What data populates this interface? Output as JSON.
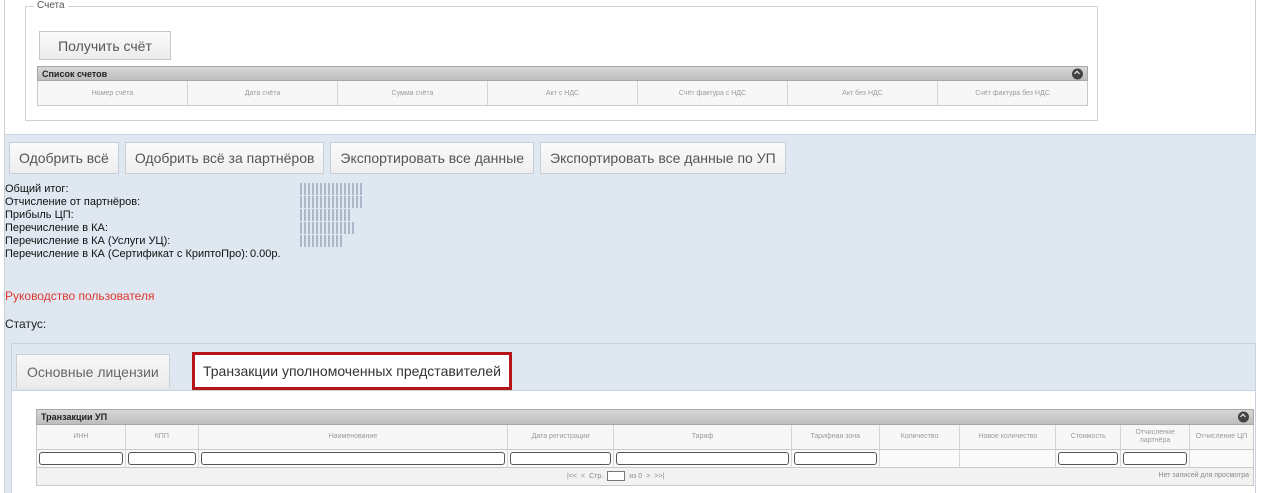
{
  "invoices": {
    "legend": "Счета",
    "get_button": "Получить счёт",
    "grid_title": "Список счетов",
    "columns": [
      "Номер счёта",
      "Дата счёта",
      "Сумма счёта",
      "Акт с НДС",
      "Счёт фактура с НДС",
      "Акт без НДС",
      "Счёт фактура без НДС"
    ]
  },
  "actions": {
    "approve_all": "Одобрить всё",
    "approve_all_partners": "Одобрить всё за партнёров",
    "export_all": "Экспортировать все данные",
    "export_all_up": "Экспортировать все данные по УП"
  },
  "totals": {
    "total_label": "Общий итог:",
    "partners_label": "Отчисление от партнёров:",
    "profit_label": "Прибыль ЦП:",
    "ka_transfer_label": "Перечисление в КА:",
    "ka_uc_label": "Перечисление в КА (Услуги УЦ):",
    "ka_crypto_label": "Перечисление в КА (Сертификат с КриптоПро):",
    "ka_crypto_value": "0.00р."
  },
  "user_guide": "Руководство пользователя",
  "status_label": "Статус:",
  "tabs": {
    "basic": "Основные лицензии",
    "transactions": "Транзакции уполномоченных представителей"
  },
  "tx_grid": {
    "title": "Транзакции УП",
    "columns": [
      "ИНН",
      "КПП",
      "Наименование",
      "Дата регистрации",
      "Тариф",
      "Тарифная зона",
      "Количество",
      "Новое количество",
      "Стоимость",
      "Отчисление партнёра",
      "Отчисление ЦП"
    ],
    "pager_page_label": "Стр.",
    "pager_of": "из 0",
    "no_records": "Нет записей для просмотра"
  },
  "colors": {
    "panel_bg": "#dfe8f1",
    "highlight_border": "#b3151a",
    "guide_link": "#e0362f"
  }
}
